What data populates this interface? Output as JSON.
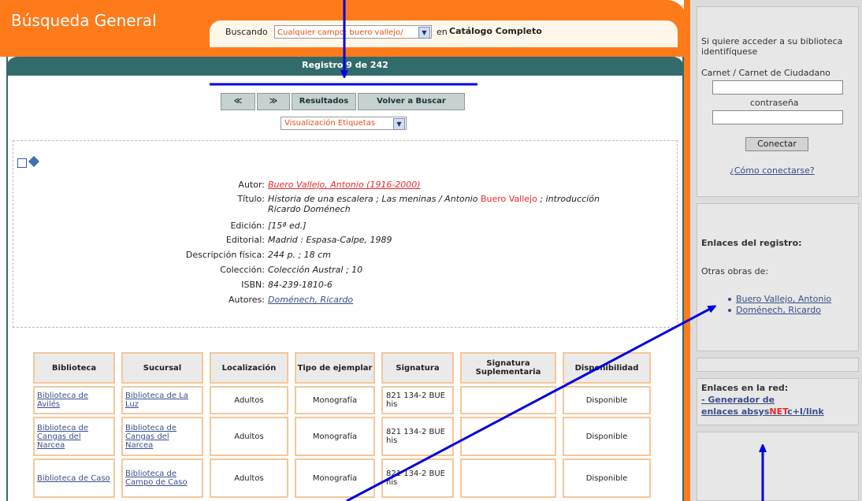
{
  "header": {
    "title": "Búsqueda General",
    "buscando_label": "Buscando",
    "search_select_value": "Cualquier campo: buero vallejo/",
    "en_label": "en",
    "catalog_label": "Catálogo Completo"
  },
  "record_bar": {
    "text": "Registro 9 de 242"
  },
  "nav": {
    "prev": "≪",
    "next": "≫",
    "results": "Resultados",
    "search_again": "Volver a Buscar",
    "view_select": "Visualización Etiquetas"
  },
  "record": {
    "autor_label": "Autor:",
    "autor_value": "Buero Vallejo, Antonio (1916-2000)",
    "titulo_label": "Título:",
    "titulo_pre": "Historia de una escalera ; Las meninas / Antonio ",
    "titulo_hl": "Buero Vallejo",
    "titulo_post": " ; introducción",
    "titulo_line2": "Ricardo Doménech",
    "edicion_label": "Edición:",
    "edicion_value": "[15ª ed.]",
    "editorial_label": "Editorial:",
    "editorial_value": "Madrid : Espasa-Calpe, 1989",
    "descripcion_label": "Descripción física:",
    "descripcion_value": "244 p. ; 18 cm",
    "coleccion_label": "Colección:",
    "coleccion_value": "Colección Austral ; 10",
    "isbn_label": "ISBN:",
    "isbn_value": "84-239-1810-6",
    "autores_label": "Autores:",
    "autores_value": "Doménech, Ricardo"
  },
  "holdings": {
    "headers": [
      "Biblioteca",
      "Sucursal",
      "Localización",
      "Tipo de ejemplar",
      "Signatura",
      "Signatura Suplementaria",
      "Disponibilidad"
    ],
    "rows": [
      [
        "Biblioteca de Avilés",
        "Biblioteca de La Luz",
        "Adultos",
        "Monografía",
        "821 134-2 BUE his",
        "",
        "Disponible"
      ],
      [
        "Biblioteca de Cangas del Narcea",
        "Biblioteca de Cangas del Narcea",
        "Adultos",
        "Monografía",
        "821 134-2 BUE his",
        "",
        "Disponible"
      ],
      [
        "Biblioteca de Caso",
        "Biblioteca de Campo de Caso",
        "Adultos",
        "Monografía",
        "821 134-2 BUE his",
        "",
        "Disponible"
      ]
    ]
  },
  "sidebar": {
    "login_intro": "Si quiere acceder a su biblioteca identifíquese",
    "carnet_label": "Carnet / Carnet de Ciudadano",
    "password_label": "contraseña",
    "connect_button": "Conectar",
    "how_link": "¿Cómo conectarse?",
    "enlaces_title": "Enlaces del registro:",
    "otras_obras": "Otras obras de:",
    "links": [
      "Buero Vallejo, Antonio",
      "Doménech, Ricardo"
    ],
    "red_title": "Enlaces en la red:",
    "generator_line1": "- Generador de",
    "generator_line2_pre": "enlaces absys",
    "generator_net": "NET",
    "generator_post": "c+I/link"
  },
  "colors": {
    "orange": "#ff7a1a",
    "teal": "#326b6b",
    "annotation_arrow": "#0000e0"
  }
}
